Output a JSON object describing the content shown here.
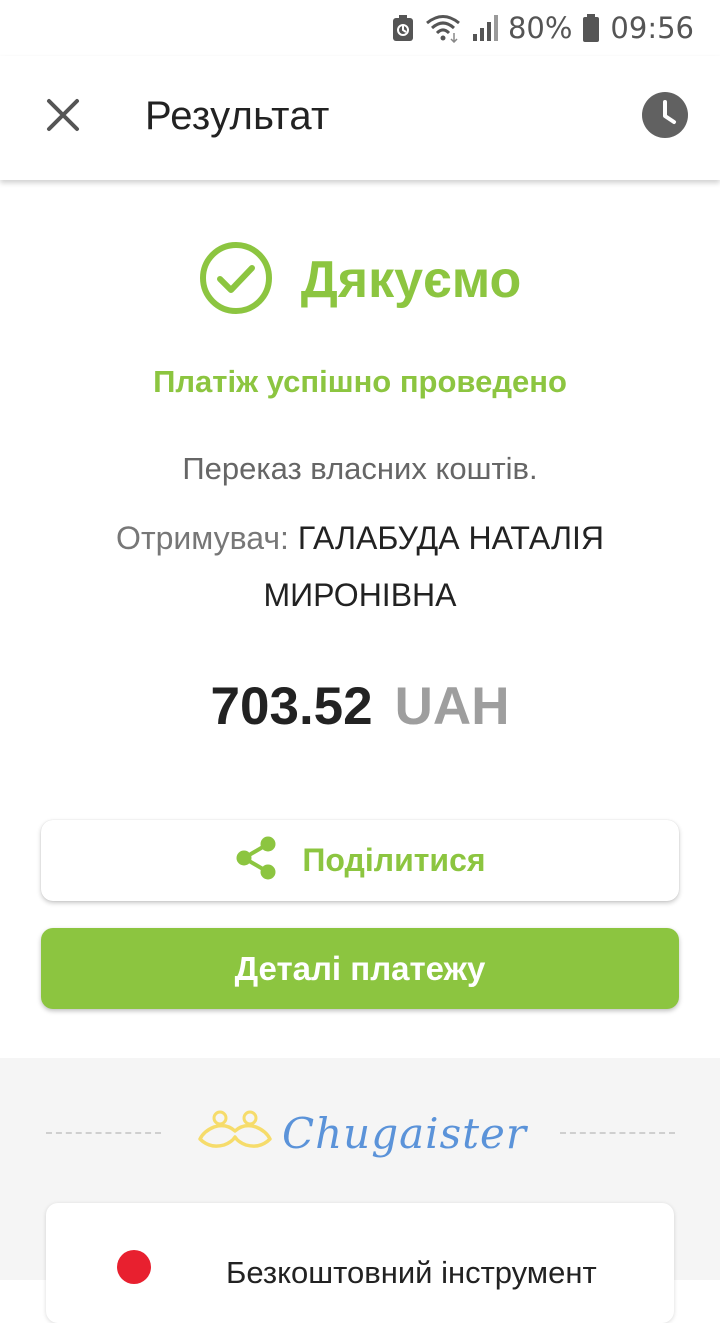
{
  "status_bar": {
    "battery_percent": "80%",
    "time": "09:56",
    "icons": [
      "battery-saver-icon",
      "wifi-icon",
      "signal-icon",
      "battery-icon"
    ]
  },
  "app_bar": {
    "title": "Результат",
    "close_icon": "close-icon",
    "history_icon": "history-clock-icon"
  },
  "result": {
    "thanks": "Дякуємо",
    "success_message": "Платіж успішно проведено",
    "description": "Переказ власних коштів.",
    "recipient_label": "Отримувач:",
    "recipient_name": "ГАЛАБУДА НАТАЛІЯ МИРОНІВНА",
    "amount": "703.52",
    "currency": "UAH"
  },
  "actions": {
    "share_label": "Поділитися",
    "details_label": "Деталі платежу"
  },
  "promo": {
    "brand": "Chugaister",
    "card_text": "Безкоштовний інструмент"
  },
  "colors": {
    "accent": "#8cc540",
    "brand_blue": "#5b93d9",
    "mustache_yellow": "#f6dc6b",
    "pin_red": "#e8202f"
  }
}
